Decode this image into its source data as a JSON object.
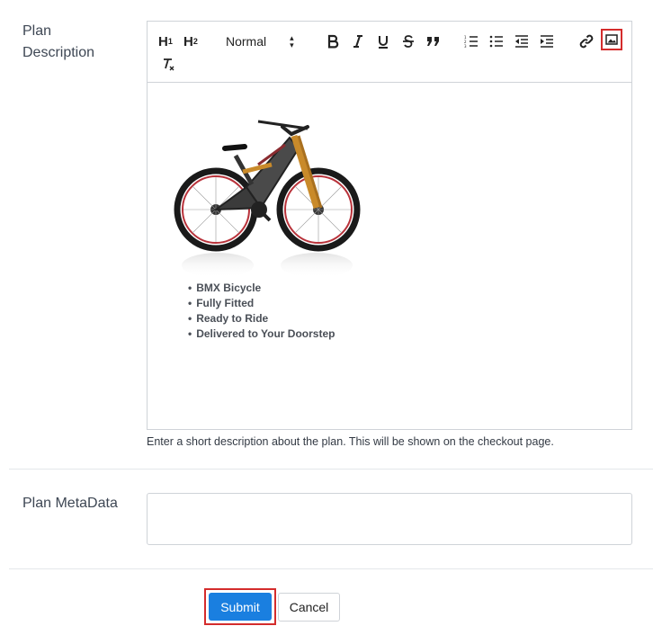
{
  "form": {
    "description_label": "Plan Description",
    "metadata_label": "Plan MetaData",
    "help_text": "Enter a short description about the plan. This will be shown on the checkout page.",
    "metadata_value": ""
  },
  "toolbar": {
    "h1_label": "H",
    "h1_sub": "1",
    "h2_label": "H",
    "h2_sub": "2",
    "format_value": "Normal",
    "icons": [
      "bold-icon",
      "italic-icon",
      "underline-icon",
      "strike-icon",
      "quote-icon",
      "ordered-list-icon",
      "bullet-list-icon",
      "outdent-icon",
      "indent-icon",
      "link-icon",
      "image-icon",
      "clear-format-icon"
    ]
  },
  "editor": {
    "image": "bicycle-image",
    "bullets": [
      "BMX Bicycle",
      "Fully Fitted",
      "Ready to Ride",
      "Delivered to Your Doorstep"
    ]
  },
  "buttons": {
    "submit": "Submit",
    "cancel": "Cancel"
  },
  "colors": {
    "primary": "#1a7fe0",
    "highlight": "#d42c2c"
  }
}
